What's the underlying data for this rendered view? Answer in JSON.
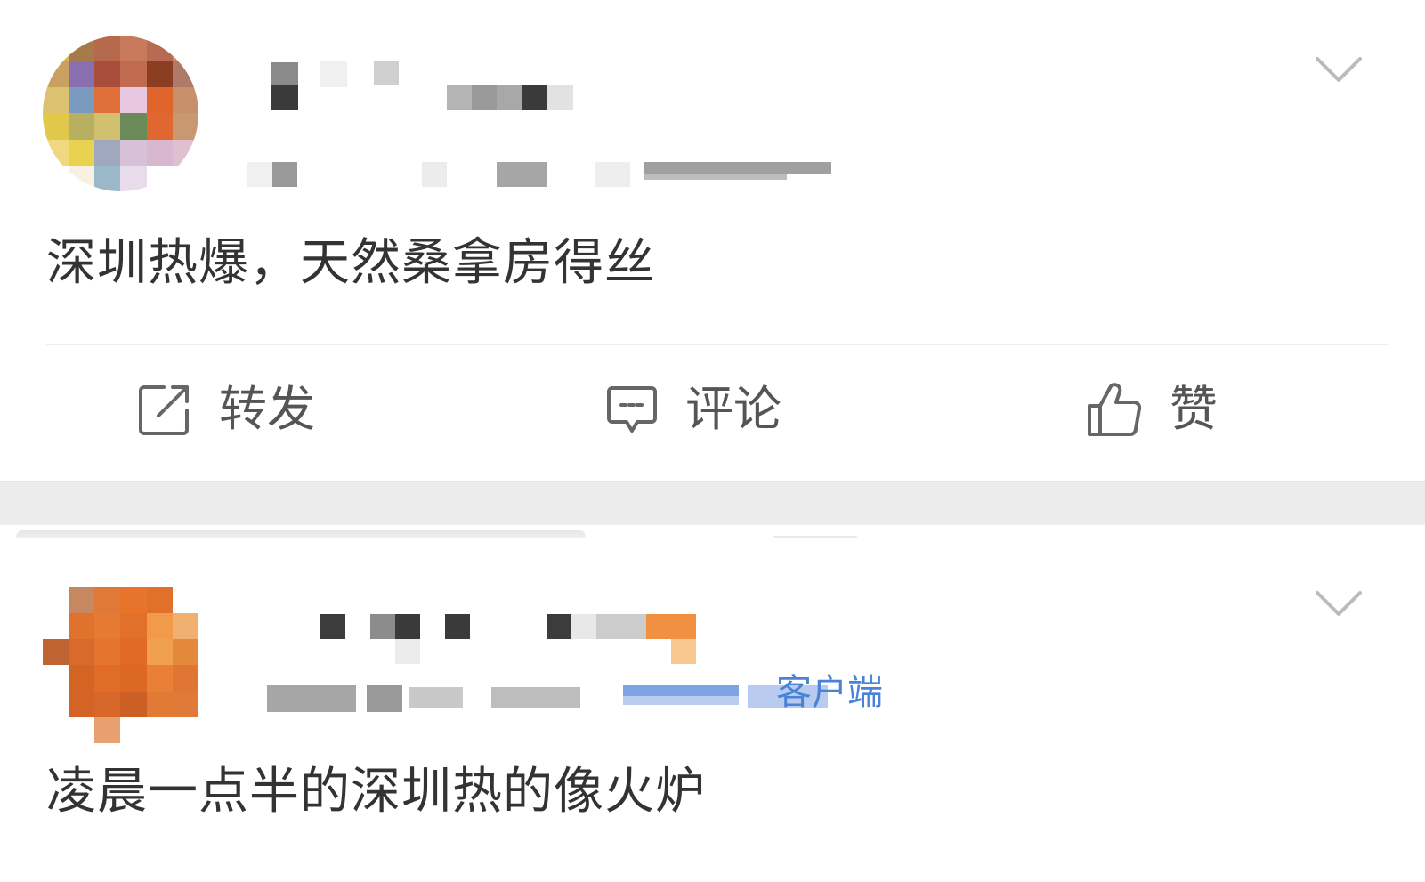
{
  "feed": {
    "posts": [
      {
        "author_name": "",
        "meta": "",
        "text": "深圳热爆，天然桑拿房得丝",
        "actions": {
          "repost": "转发",
          "comment": "评论",
          "like": "赞"
        },
        "icons": {
          "menu": "chevron-down-icon",
          "repost": "repost-icon",
          "comment": "comment-icon",
          "like": "thumbs-up-icon"
        }
      },
      {
        "author_name": "",
        "meta_time": "",
        "meta_source": "客户端",
        "text": "凌晨一点半的深圳热的像火炉",
        "icons": {
          "menu": "chevron-down-icon"
        }
      }
    ]
  },
  "colors": {
    "background": "#ffffff",
    "separator": "#ececec",
    "text": "#333333",
    "action_text": "#555555",
    "source_link": "#3d7bd8",
    "icon": "#666666",
    "chevron": "#bbbbbb"
  }
}
